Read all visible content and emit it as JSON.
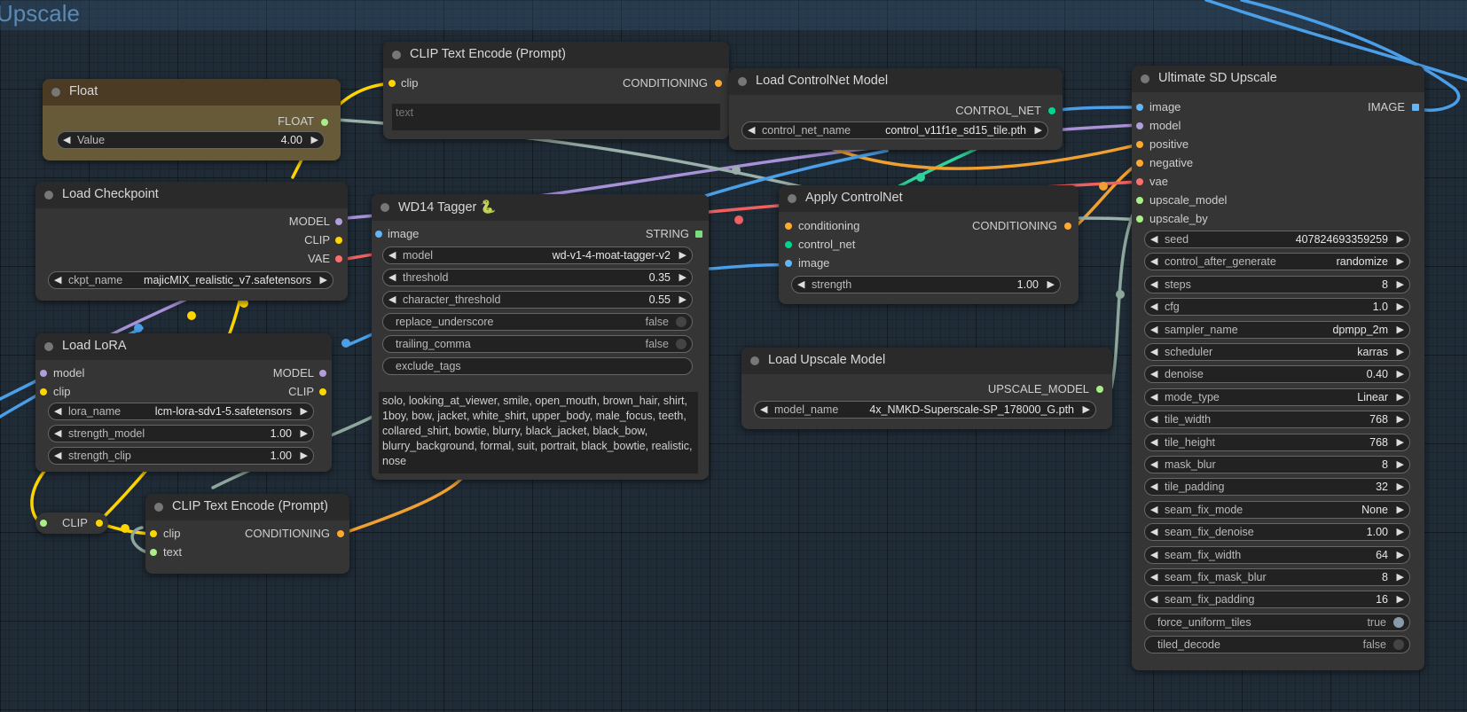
{
  "group": {
    "title": "Upscale"
  },
  "nodes": {
    "float": {
      "title": "Float",
      "output": "FLOAT",
      "value_label": "Value",
      "value": "4.00"
    },
    "clip_top": {
      "title": "CLIP Text Encode (Prompt)",
      "input_clip": "clip",
      "output": "CONDITIONING",
      "text_placeholder": "text"
    },
    "load_controlnet": {
      "title": "Load ControlNet Model",
      "output": "CONTROL_NET",
      "w_label": "control_net_name",
      "w_value": "control_v11f1e_sd15_tile.pth"
    },
    "checkpoint": {
      "title": "Load Checkpoint",
      "outputs": [
        "MODEL",
        "CLIP",
        "VAE"
      ],
      "w_label": "ckpt_name",
      "w_value": "majicMIX_realistic_v7.safetensors"
    },
    "wd14": {
      "title": "WD14 Tagger 🐍",
      "input": "image",
      "output": "STRING",
      "widgets": [
        {
          "label": "model",
          "value": "wd-v1-4-moat-tagger-v2"
        },
        {
          "label": "threshold",
          "value": "0.35"
        },
        {
          "label": "character_threshold",
          "value": "0.55"
        }
      ],
      "toggles": [
        {
          "label": "replace_underscore",
          "value": "false"
        },
        {
          "label": "trailing_comma",
          "value": "false"
        }
      ],
      "exclude_label": "exclude_tags",
      "tags_text": "solo, looking_at_viewer, smile, open_mouth, brown_hair, shirt, 1boy, bow, jacket, white_shirt, upper_body, male_focus, teeth, collared_shirt, bowtie, blurry, black_jacket, black_bow, blurry_background, formal, suit, portrait, black_bowtie, realistic, nose"
    },
    "apply_controlnet": {
      "title": "Apply ControlNet",
      "inputs": [
        "conditioning",
        "control_net",
        "image"
      ],
      "output": "CONDITIONING",
      "w_label": "strength",
      "w_value": "1.00"
    },
    "lora": {
      "title": "Load LoRA",
      "inputs": [
        "model",
        "clip"
      ],
      "outputs": [
        "MODEL",
        "CLIP"
      ],
      "widgets": [
        {
          "label": "lora_name",
          "value": "lcm-lora-sdv1-5.safetensors"
        },
        {
          "label": "strength_model",
          "value": "1.00"
        },
        {
          "label": "strength_clip",
          "value": "1.00"
        }
      ]
    },
    "upscale_model": {
      "title": "Load Upscale Model",
      "output": "UPSCALE_MODEL",
      "w_label": "model_name",
      "w_value": "4x_NMKD-Superscale-SP_178000_G.pth"
    },
    "reroute": {
      "label": "CLIP"
    },
    "clip_bottom": {
      "title": "CLIP Text Encode (Prompt)",
      "inputs": [
        "clip",
        "text"
      ],
      "output": "CONDITIONING"
    },
    "ultimate": {
      "title": "Ultimate SD Upscale",
      "inputs": [
        "image",
        "model",
        "positive",
        "negative",
        "vae",
        "upscale_model",
        "upscale_by"
      ],
      "output": "IMAGE",
      "widgets": [
        {
          "label": "seed",
          "value": "407824693359259"
        },
        {
          "label": "control_after_generate",
          "value": "randomize"
        },
        {
          "label": "steps",
          "value": "8"
        },
        {
          "label": "cfg",
          "value": "1.0"
        },
        {
          "label": "sampler_name",
          "value": "dpmpp_2m"
        },
        {
          "label": "scheduler",
          "value": "karras"
        },
        {
          "label": "denoise",
          "value": "0.40"
        },
        {
          "label": "mode_type",
          "value": "Linear"
        },
        {
          "label": "tile_width",
          "value": "768"
        },
        {
          "label": "tile_height",
          "value": "768"
        },
        {
          "label": "mask_blur",
          "value": "8"
        },
        {
          "label": "tile_padding",
          "value": "32"
        },
        {
          "label": "seam_fix_mode",
          "value": "None"
        },
        {
          "label": "seam_fix_denoise",
          "value": "1.00"
        },
        {
          "label": "seam_fix_width",
          "value": "64"
        },
        {
          "label": "seam_fix_mask_blur",
          "value": "8"
        },
        {
          "label": "seam_fix_padding",
          "value": "16"
        }
      ],
      "toggles": [
        {
          "label": "force_uniform_tiles",
          "value": "true"
        },
        {
          "label": "tiled_decode",
          "value": "false"
        }
      ]
    }
  },
  "colors": {
    "model": "#b39ddb",
    "clip": "#ffd500",
    "vae": "#ff6e6e",
    "conditioning": "#ffa931",
    "control_net": "#00d78d",
    "image": "#64b5f6",
    "float": "#aaee88",
    "upscale_model": "#aaee88",
    "float_node_bg": "#675a38",
    "float_node_title": "#4b3a24"
  }
}
